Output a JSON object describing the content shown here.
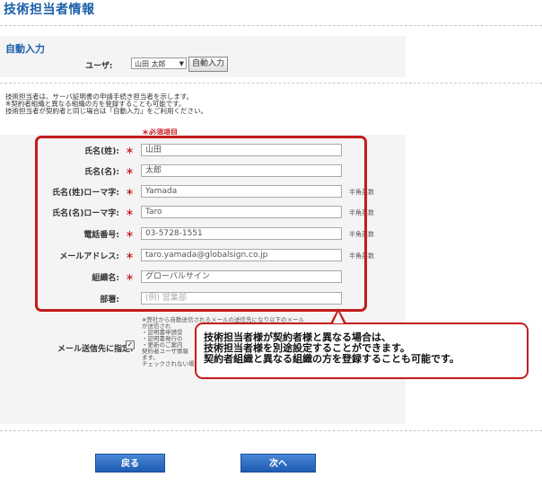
{
  "page_title": "技術担当者情報",
  "auto_input": {
    "title": "自動入力",
    "user_label": "ユーザ:",
    "user_select_value": "山田 太郎",
    "button_label": "自動入力"
  },
  "description": [
    "技術担当者は、サーバ証明書の申請手続き担当者を示します。",
    "※契約者組織と異なる組織の方を登録することも可能です。",
    "技術担当者が契約者と同じ場合は「自動入力」をご利用ください。"
  ],
  "required_note": "＊必須項目",
  "form": {
    "rows": [
      {
        "label": "氏名(姓):",
        "required": "＊",
        "value": "山田",
        "placeholder": "",
        "suffix": ""
      },
      {
        "label": "氏名(名):",
        "required": "＊",
        "value": "太郎",
        "placeholder": "",
        "suffix": ""
      },
      {
        "label": "氏名(姓)ローマ字:",
        "required": "＊",
        "value": "Yamada",
        "placeholder": "",
        "suffix": "半角英数"
      },
      {
        "label": "氏名(名)ローマ字:",
        "required": "＊",
        "value": "Taro",
        "placeholder": "",
        "suffix": "半角英数"
      },
      {
        "label": "電話番号:",
        "required": "＊",
        "value": "03-5728-1551",
        "placeholder": "",
        "suffix": "半角英数"
      },
      {
        "label": "メールアドレス:",
        "required": "＊",
        "value": "taro.yamada@globalsign.co.jp",
        "placeholder": "",
        "suffix": "半角英数"
      },
      {
        "label": "組織名:",
        "required": "＊",
        "value": "グローバルサイン",
        "placeholder": "",
        "suffix": ""
      },
      {
        "label": "部署:",
        "required": "",
        "value": "",
        "placeholder": "(例) 営業部",
        "suffix": ""
      }
    ]
  },
  "mail": {
    "label": "メール送信先に指定:",
    "checked_mark": "✓",
    "note_lines": [
      "※弊社から自動送信されるメールの送信先になり以下のメール",
      "が送信され",
      "・証明書申請受",
      "・証明書発行の",
      "・更新のご案内",
      "契約者ユーザ情報",
      "ます。",
      "チェックされない場"
    ]
  },
  "callout": {
    "lines": [
      "技術担当者様が契約者様と異なる場合は、",
      "技術担当者様を別途設定することができます。",
      "契約者組織と異なる組織の方を登録することも可能です。"
    ]
  },
  "buttons": {
    "back": "戻る",
    "next": "次へ"
  },
  "colors": {
    "title_blue": "#1a5fa8",
    "required_red": "#c4171c",
    "highlight_red": "#c41c1c",
    "button_blue": "#2a6cc4"
  }
}
